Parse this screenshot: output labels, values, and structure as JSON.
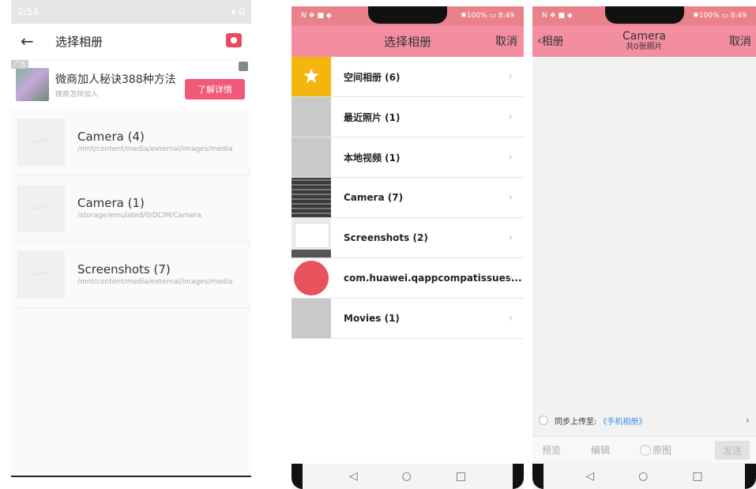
{
  "left": {
    "status_time": "2:54",
    "status_right": "0",
    "title": "选择相册",
    "ad": {
      "tag": "广告",
      "title": "微商加人秘诀388种方法",
      "subtitle": "微商怎样加人",
      "button": "了解详情"
    },
    "albums": [
      {
        "name": "Camera (4)",
        "path": "/mnt/content/media/external/images/media"
      },
      {
        "name": "Camera (1)",
        "path": "/storage/emulated/0/DCIM/Camera"
      },
      {
        "name": "Screenshots (7)",
        "path": "/mnt/content/media/external/images/media"
      }
    ]
  },
  "middle": {
    "status_left": "N ❖ ■ ◆",
    "status_right": "✱100% ▭ 8:49",
    "title": "选择相册",
    "cancel": "取消",
    "albums": [
      {
        "label": "空间相册 (6)",
        "thumb": "star"
      },
      {
        "label": "最近照片 (1)",
        "thumb": "gray"
      },
      {
        "label": "本地视频 (1)",
        "thumb": "gray"
      },
      {
        "label": "Camera (7)",
        "thumb": "keyboard"
      },
      {
        "label": "Screenshots (2)",
        "thumb": "shot"
      },
      {
        "label": "com.huawei.qappcompatissues...",
        "thumb": "apple"
      },
      {
        "label": "Movies (1)",
        "thumb": "gray"
      }
    ]
  },
  "right": {
    "status_left": "N ❖ ■ ◆",
    "status_right": "✱100% ▭ 8:49",
    "back": "相册",
    "title": "Camera",
    "subtitle": "共0张照片",
    "cancel": "取消",
    "sync_label": "同步上传至:",
    "sync_target": "《手机相册》",
    "preview": "预览",
    "edit": "编辑",
    "original": "原图",
    "send": "发送"
  },
  "nav": {
    "back": "◁",
    "home": "○",
    "recent": "□"
  }
}
